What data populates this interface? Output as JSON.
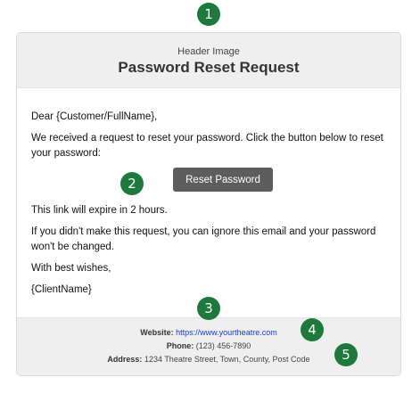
{
  "badges": [
    "1",
    "2",
    "3",
    "4",
    "5"
  ],
  "header": {
    "caption": "Header Image",
    "title": "Password Reset Request"
  },
  "body": {
    "greeting": "Dear {Customer/FullName},",
    "intro_line1": "We received a request to reset your password. Click the button below to reset",
    "intro_line2": "your password:",
    "button_label": "Reset Password",
    "expiry": "This link will expire in 2 hours.",
    "ignore_line1": "If you didn't make this request, you can ignore this email and your password",
    "ignore_line2": "won't be changed.",
    "closing": "With best wishes,",
    "signature": "{ClientName}"
  },
  "footer": {
    "website_label": "Website:",
    "website_url": "https://www.yourtheatre.com",
    "phone_label": "Phone:",
    "phone_value": "(123) 456-7890",
    "address_label": "Address:",
    "address_value": "1234 Theatre Street, Town, County, Post Code"
  },
  "colors": {
    "badge": "#1e7a3c",
    "button": "#5d5d5d",
    "link": "#1a3bcc",
    "header_bg": "#efefef"
  }
}
